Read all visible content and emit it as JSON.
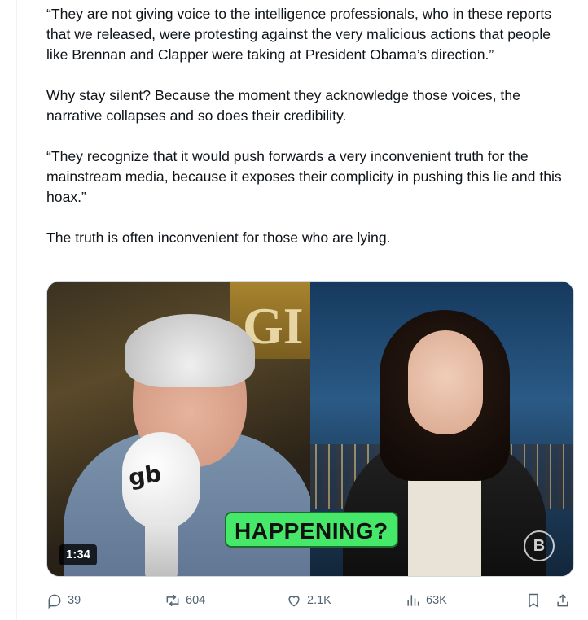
{
  "post": {
    "paragraphs": [
      "“They are not giving voice to the intelligence professionals, who in these reports that we released, were protesting against the very malicious actions that people like Brennan and Clapper were taking at President Obama’s direction.”",
      "Why stay silent? Because the moment they acknowledge those voices, the narrative collapses and so does their credibility.",
      "“They recognize that it would push forwards a very inconvenient truth for the mainstream media, because it exposes their complicity in pushing this lie and this hoax.”",
      "The truth is often inconvenient for those who are lying."
    ]
  },
  "media": {
    "caption": "HAPPENING?",
    "duration": "1:34",
    "mic_label": "gb",
    "sign_text": "GI",
    "watermark": "B"
  },
  "actions": {
    "replies": "39",
    "reposts": "604",
    "likes": "2.1K",
    "views": "63K"
  },
  "icons": {
    "reply": "reply-icon",
    "repost": "repost-icon",
    "like": "heart-icon",
    "views": "views-icon",
    "bookmark": "bookmark-icon",
    "share": "share-icon"
  },
  "colors": {
    "text": "#0f1419",
    "secondary": "#536471",
    "caption_bg": "#46e86a"
  }
}
